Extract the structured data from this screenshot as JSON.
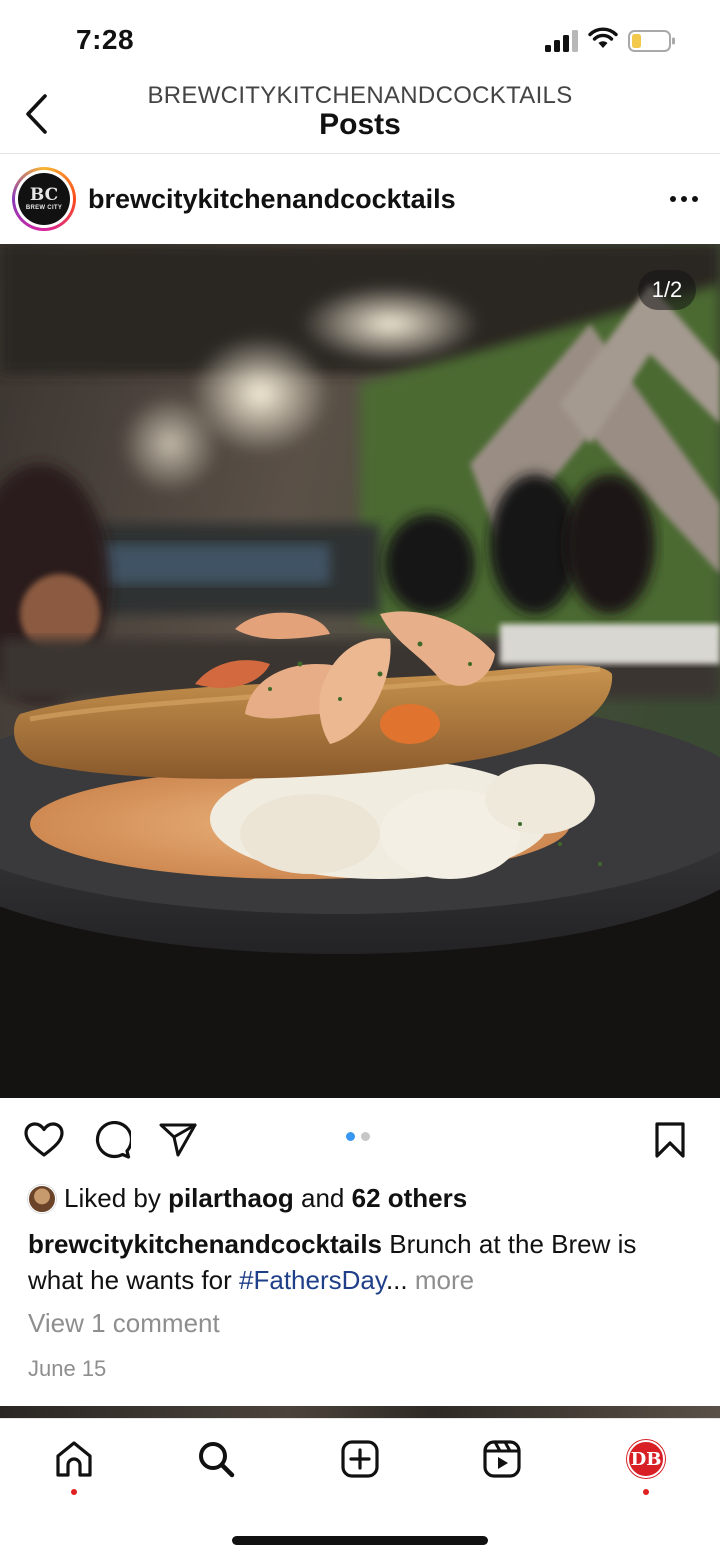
{
  "status_bar": {
    "time": "7:28",
    "signal_icon": "cellular-signal-icon",
    "wifi_icon": "wifi-icon",
    "battery_icon": "battery-low-icon",
    "battery_color": "#f2c94c"
  },
  "header": {
    "account": "BREWCITYKITCHENANDCOCKTAILS",
    "title": "Posts",
    "back_icon": "chevron-left-icon"
  },
  "post": {
    "username": "brewcitykitchenandcocktails",
    "avatar": {
      "icon": "brand-logo-avatar",
      "monogram": "BC",
      "brand": "BREW CITY"
    },
    "more_icon": "ellipsis-horizontal-icon",
    "photo": {
      "icon": "food-photo",
      "counter": "1/2",
      "current_index": 1,
      "total": 2
    },
    "actions": {
      "like_icon": "heart-outline-icon",
      "comment_icon": "speech-bubble-icon",
      "share_icon": "paper-plane-icon",
      "save_icon": "bookmark-outline-icon"
    },
    "carousel_dots": {
      "active_color": "#3897f0",
      "inactive_color": "#c7c7c7"
    },
    "likes": {
      "prefix": "Liked by",
      "liker": "pilarthaog",
      "conjunction": "and",
      "others": "62 others"
    },
    "caption": {
      "author": "brewcitykitchenandcocktails",
      "text_1": "Brunch at the Brew is what he wants for",
      "hashtag": "#FathersDay",
      "ellipsis": "...",
      "more": "more"
    },
    "view_comments": "View 1 comment",
    "date": "June 15"
  },
  "tab_bar": {
    "items": [
      {
        "icon": "home-icon",
        "has_dot": true
      },
      {
        "icon": "search-icon",
        "has_dot": false
      },
      {
        "icon": "create-plus-icon",
        "has_dot": false
      },
      {
        "icon": "reels-icon",
        "has_dot": false
      },
      {
        "icon": "profile-avatar",
        "has_dot": true
      }
    ],
    "profile_monogram": "DB",
    "notification_color": "#e02020"
  }
}
